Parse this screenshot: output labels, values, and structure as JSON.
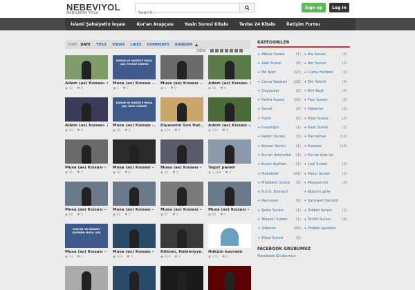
{
  "header": {
    "logo": "NEBEVIYOL",
    "tagline": "NEBILERIN YOLU",
    "search_placeholder": "Search...",
    "signup_label": "Sign up",
    "login_label": "Log In"
  },
  "nav": {
    "items": [
      {
        "label": "İslami Şahsiyetin İnşası"
      },
      {
        "label": "Kur'an Arapçası"
      },
      {
        "label": "Yasin Suresi Kitabı"
      },
      {
        "label": "Tevbe 24 Kitabı"
      },
      {
        "label": "İletişim Formu"
      }
    ]
  },
  "sort": {
    "label": "SORT:",
    "options": [
      "DATE",
      "TITLE",
      "VIEWS",
      "LIKES",
      "COMMENTS",
      "RANDOM"
    ],
    "view_label": "VIEW:"
  },
  "videos": [
    {
      "title": "Adem (as) Kıssası- 4",
      "views": "42",
      "likes": "0"
    },
    {
      "title": "Musa (as) Kıssası -...",
      "views": "0",
      "likes": "0"
    },
    {
      "title": "Musa (as) Kıssası -...",
      "views": "6",
      "likes": "0"
    },
    {
      "title": "Adem (as) Kıssası- 3",
      "views": "50",
      "likes": "0"
    },
    {
      "title": "Adem (as) Kıssası- 2",
      "views": "60",
      "likes": "0"
    },
    {
      "title": "Musa (as) Kıssası -...",
      "views": "68",
      "likes": "0"
    },
    {
      "title": "Diyanetin Son Hut...",
      "views": "429",
      "likes": "0"
    },
    {
      "title": "Adem (as) Kıssası -...",
      "views": "104",
      "likes": "0"
    },
    {
      "title": "Musa (as) Kıssası – 9",
      "views": "41",
      "likes": "0"
    },
    {
      "title": "Musa (as) Kıssası – 8",
      "views": "29",
      "likes": "0"
    },
    {
      "title": "Musa (as) Kıssası – 7",
      "views": "36",
      "likes": "0"
    },
    {
      "title": "Tağut paneli",
      "views": "1,288",
      "likes": "0"
    },
    {
      "title": "Musa (as) Kıssası – 6",
      "views": "66",
      "likes": "0"
    },
    {
      "title": "Musa (as) Kıssası – 5",
      "views": "66",
      "likes": "0"
    },
    {
      "title": "Musa (as) Kıssası – 4",
      "views": "81",
      "likes": "0"
    },
    {
      "title": "Musa (as) Kıssası – 3",
      "views": "85",
      "likes": "0"
    },
    {
      "title": "Musa (as) Kıssası – 2",
      "views": "74",
      "likes": "0"
    },
    {
      "title": "Musa (as) Kıssası – 1",
      "views": "104",
      "likes": "0"
    },
    {
      "title": "Hüküm, Hakimiyye...",
      "views": "424",
      "likes": "0"
    },
    {
      "title": "Hüküm kavramı",
      "views": "170",
      "likes": "0"
    }
  ],
  "thumb_captions": {
    "kuran_1": "KURAN VE HADİSTE MUSA (AS) TEVRAT HÜKMÜ",
    "kuran_2": "KURAN VE HADİSTE MUSA (AS) İNCİL HÜKMÜ",
    "kuran_3": "KUR'AN VE SÜNNET IŞIĞINDA MUSA (AS)"
  },
  "sidebar": {
    "categories_title": "KATEGORILER",
    "categories": [
      {
        "name": "Abese Suresi",
        "count": "(1)"
      },
      {
        "name": "Ala Suresi",
        "count": "(2)"
      },
      {
        "name": "Alak Suresi",
        "count": "(4)"
      },
      {
        "name": "Asr Suresi",
        "count": "(2)"
      },
      {
        "name": "Bir Ayet",
        "count": "(17)"
      },
      {
        "name": "Cuma Hutbesi",
        "count": "(1)"
      },
      {
        "name": "Cuma Vaazları",
        "count": "(22)"
      },
      {
        "name": "Din Tahrifi",
        "count": "(4)"
      },
      {
        "name": "Duyurular",
        "count": "(2)"
      },
      {
        "name": "Ehli Beyt",
        "count": "(5)"
      },
      {
        "name": "Fatiha Suresi",
        "count": "(13)"
      },
      {
        "name": "Fecr Suresi",
        "count": "(2)"
      },
      {
        "name": "Genel",
        "count": "(2)"
      },
      {
        "name": "Haberler",
        "count": "(2)"
      },
      {
        "name": "Hadis",
        "count": "(5)"
      },
      {
        "name": "İhlas Suresi",
        "count": "(2)"
      },
      {
        "name": "İnsanlığın",
        "count": "(1)"
      },
      {
        "name": "Kadr Suresi",
        "count": "(1)"
      },
      {
        "name": "Kalem Suresi",
        "count": "(3)"
      },
      {
        "name": "Kavramlar",
        "count": "(13)"
      },
      {
        "name": "Kevser Suresi",
        "count": "(1)"
      },
      {
        "name": "Kıssalar",
        "count": "(14)"
      },
      {
        "name": "Kur'an Atmosferi",
        "count": "(1)"
      },
      {
        "name": "Kur'an bize ne",
        "count": ""
      },
      {
        "name": "Kuran Ayetleri",
        "count": "(1)"
      },
      {
        "name": "Leyl Suresi",
        "count": "(2)"
      },
      {
        "name": "Makaleler",
        "count": "(24)"
      },
      {
        "name": "Maun Suresi",
        "count": "(1)"
      },
      {
        "name": "Müddesir Suresi",
        "count": "(3)"
      },
      {
        "name": "Müzzemmil",
        "count": "(3)"
      },
      {
        "name": "N.S.G. Esmau'l",
        "count": ""
      },
      {
        "name": "Nüzul'e göre",
        "count": ""
      },
      {
        "name": "Ramazan",
        "count": "(1)"
      },
      {
        "name": "Şahsiyet Dersleri",
        "count": ""
      },
      {
        "name": "Şems Suresi",
        "count": "(1)"
      },
      {
        "name": "Tebbet Suresi",
        "count": "(1)"
      },
      {
        "name": "Tekasür Suresi",
        "count": "(1)"
      },
      {
        "name": "Tevhit Suresi",
        "count": "(6)"
      },
      {
        "name": "Videolar",
        "count": "(93)"
      },
      {
        "name": "Yoldaki İşaretler",
        "count": ""
      },
      {
        "name": "Zilzal Suresi",
        "count": "(2)"
      }
    ],
    "facebook_title": "FACEBOOK GRUBUMUZ",
    "facebook_link": "Facebook Grubumuz"
  }
}
